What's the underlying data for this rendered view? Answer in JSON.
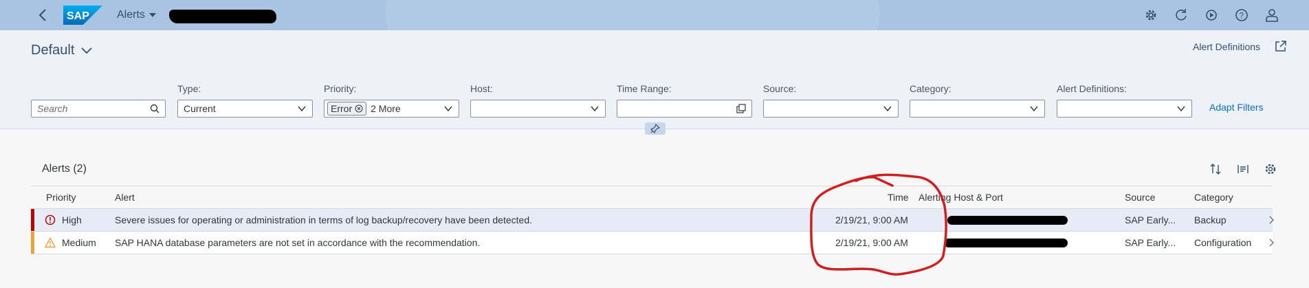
{
  "shell": {
    "app_title": "Alerts",
    "icons": [
      "back-icon",
      "settings-gear-icon",
      "refresh-icon",
      "play-icon",
      "help-icon",
      "user-icon"
    ]
  },
  "header": {
    "variant": "Default",
    "alert_definitions_link": "Alert Definitions"
  },
  "filters": {
    "search_placeholder": "Search",
    "type_label": "Type:",
    "type_value": "Current",
    "priority_label": "Priority:",
    "priority_token": "Error",
    "priority_more": "2 More",
    "host_label": "Host:",
    "time_range_label": "Time Range:",
    "source_label": "Source:",
    "category_label": "Category:",
    "alert_definitions_label": "Alert Definitions:",
    "adapt_filters": "Adapt Filters"
  },
  "table": {
    "title": "Alerts (2)",
    "columns": {
      "priority": "Priority",
      "alert": "Alert",
      "time": "Time",
      "host": "Alerting Host & Port",
      "source": "Source",
      "category": "Category"
    },
    "rows": [
      {
        "priority": "High",
        "priority_color": "#bb0000",
        "alert": "Severe issues for operating or administration in terms of log backup/recovery have been detected.",
        "time": "2/19/21, 9:00 AM",
        "source": "SAP Early...",
        "category": "Backup"
      },
      {
        "priority": "Medium",
        "priority_color": "#e9a53b",
        "alert": "SAP HANA database parameters are not set in accordance with the recommendation.",
        "time": "2/19/21, 9:00 AM",
        "source": "SAP Early...",
        "category": "Configuration"
      }
    ]
  },
  "colors": {
    "shell_bg": "#a9c3e2",
    "link": "#0a6ed1",
    "annotation_red": "#d01f1f"
  }
}
